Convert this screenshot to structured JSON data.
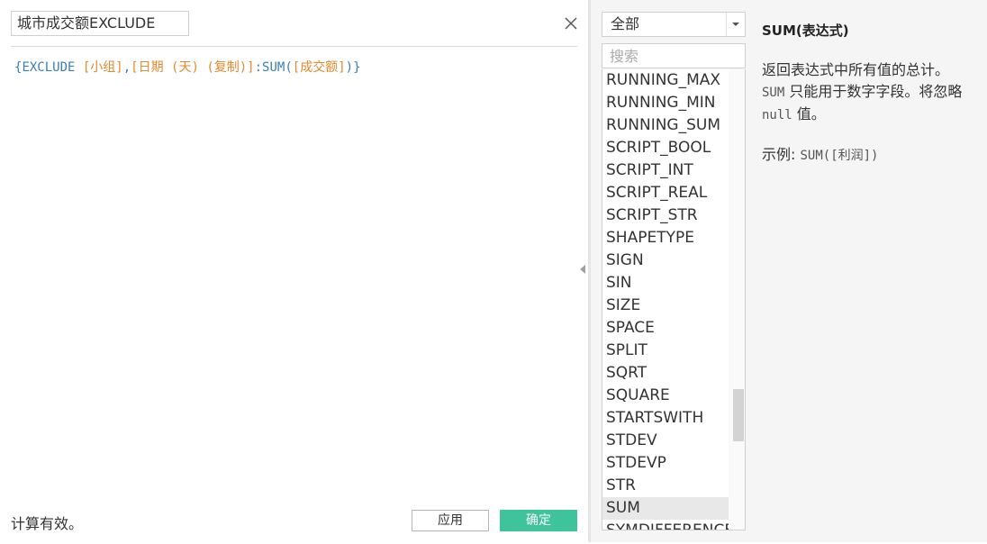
{
  "editor": {
    "calc_name": "城市成交额EXCLUDE",
    "formula_tokens": [
      {
        "text": "{",
        "kind": "brace"
      },
      {
        "text": "EXCLUDE ",
        "kind": "kw"
      },
      {
        "text": "[小组]",
        "kind": "field"
      },
      {
        "text": ",",
        "kind": "punct"
      },
      {
        "text": "[日期 (天) (复制)]",
        "kind": "field"
      },
      {
        "text": ":",
        "kind": "punct"
      },
      {
        "text": "SUM",
        "kind": "kw"
      },
      {
        "text": "(",
        "kind": "punct"
      },
      {
        "text": "[成交额]",
        "kind": "field"
      },
      {
        "text": ")",
        "kind": "punct"
      },
      {
        "text": "}",
        "kind": "brace"
      }
    ],
    "status": "计算有效。",
    "apply_label": "应用",
    "ok_label": "确定"
  },
  "functions": {
    "category_selected": "全部",
    "search_placeholder": "搜索",
    "items": [
      "RUNNING_MAX",
      "RUNNING_MIN",
      "RUNNING_SUM",
      "SCRIPT_BOOL",
      "SCRIPT_INT",
      "SCRIPT_REAL",
      "SCRIPT_STR",
      "SHAPETYPE",
      "SIGN",
      "SIN",
      "SIZE",
      "SPACE",
      "SPLIT",
      "SQRT",
      "SQUARE",
      "STARTSWITH",
      "STDEV",
      "STDEVP",
      "STR",
      "SUM",
      "SYMDIFFERENCE"
    ],
    "selected": "SUM"
  },
  "description": {
    "title": "SUM(表达式)",
    "line1": "返回表达式中所有值的总计。",
    "code1": "SUM",
    "line2": " 只能用于数字字段。将忽略 ",
    "code2": "null",
    "line3": " 值。",
    "example_label": "示例: ",
    "example_code": "SUM([利润])"
  },
  "colors": {
    "keyword": "#3a7fb5",
    "field": "#e08a2c",
    "ok_button": "#3ec39a"
  }
}
